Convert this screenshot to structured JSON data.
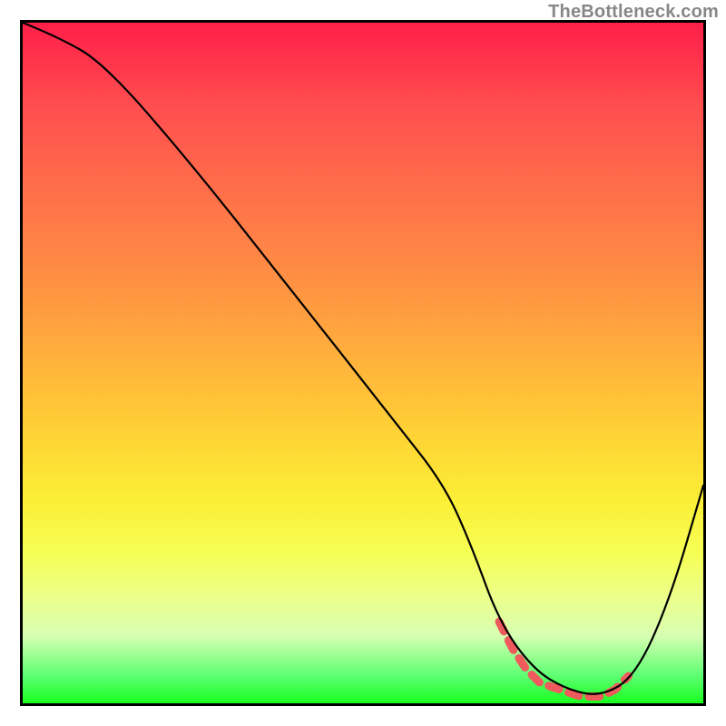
{
  "attribution": "TheBottleneck.com",
  "chart_data": {
    "type": "line",
    "title": "",
    "xlabel": "",
    "ylabel": "",
    "xlim": [
      0,
      100
    ],
    "ylim": [
      0,
      100
    ],
    "background_gradient": {
      "top_color": "#ff1f49",
      "mid_color": "#ffd135",
      "bottom_color": "#1aff1e"
    },
    "series": [
      {
        "name": "main-curve",
        "x": [
          0,
          5,
          12,
          25,
          40,
          55,
          62,
          66,
          70,
          75,
          80,
          85,
          90,
          95,
          100
        ],
        "values": [
          100,
          98,
          94,
          79,
          60,
          41,
          32,
          23,
          12,
          5,
          2,
          1,
          4,
          15,
          32
        ]
      }
    ],
    "highlight_segment": {
      "name": "optimal-range-marker",
      "color": "#ef5a5d",
      "x": [
        70,
        72,
        74,
        76,
        79,
        82,
        85,
        87,
        89
      ],
      "values": [
        12,
        8,
        5,
        3,
        2,
        1,
        1,
        2,
        4
      ]
    }
  }
}
